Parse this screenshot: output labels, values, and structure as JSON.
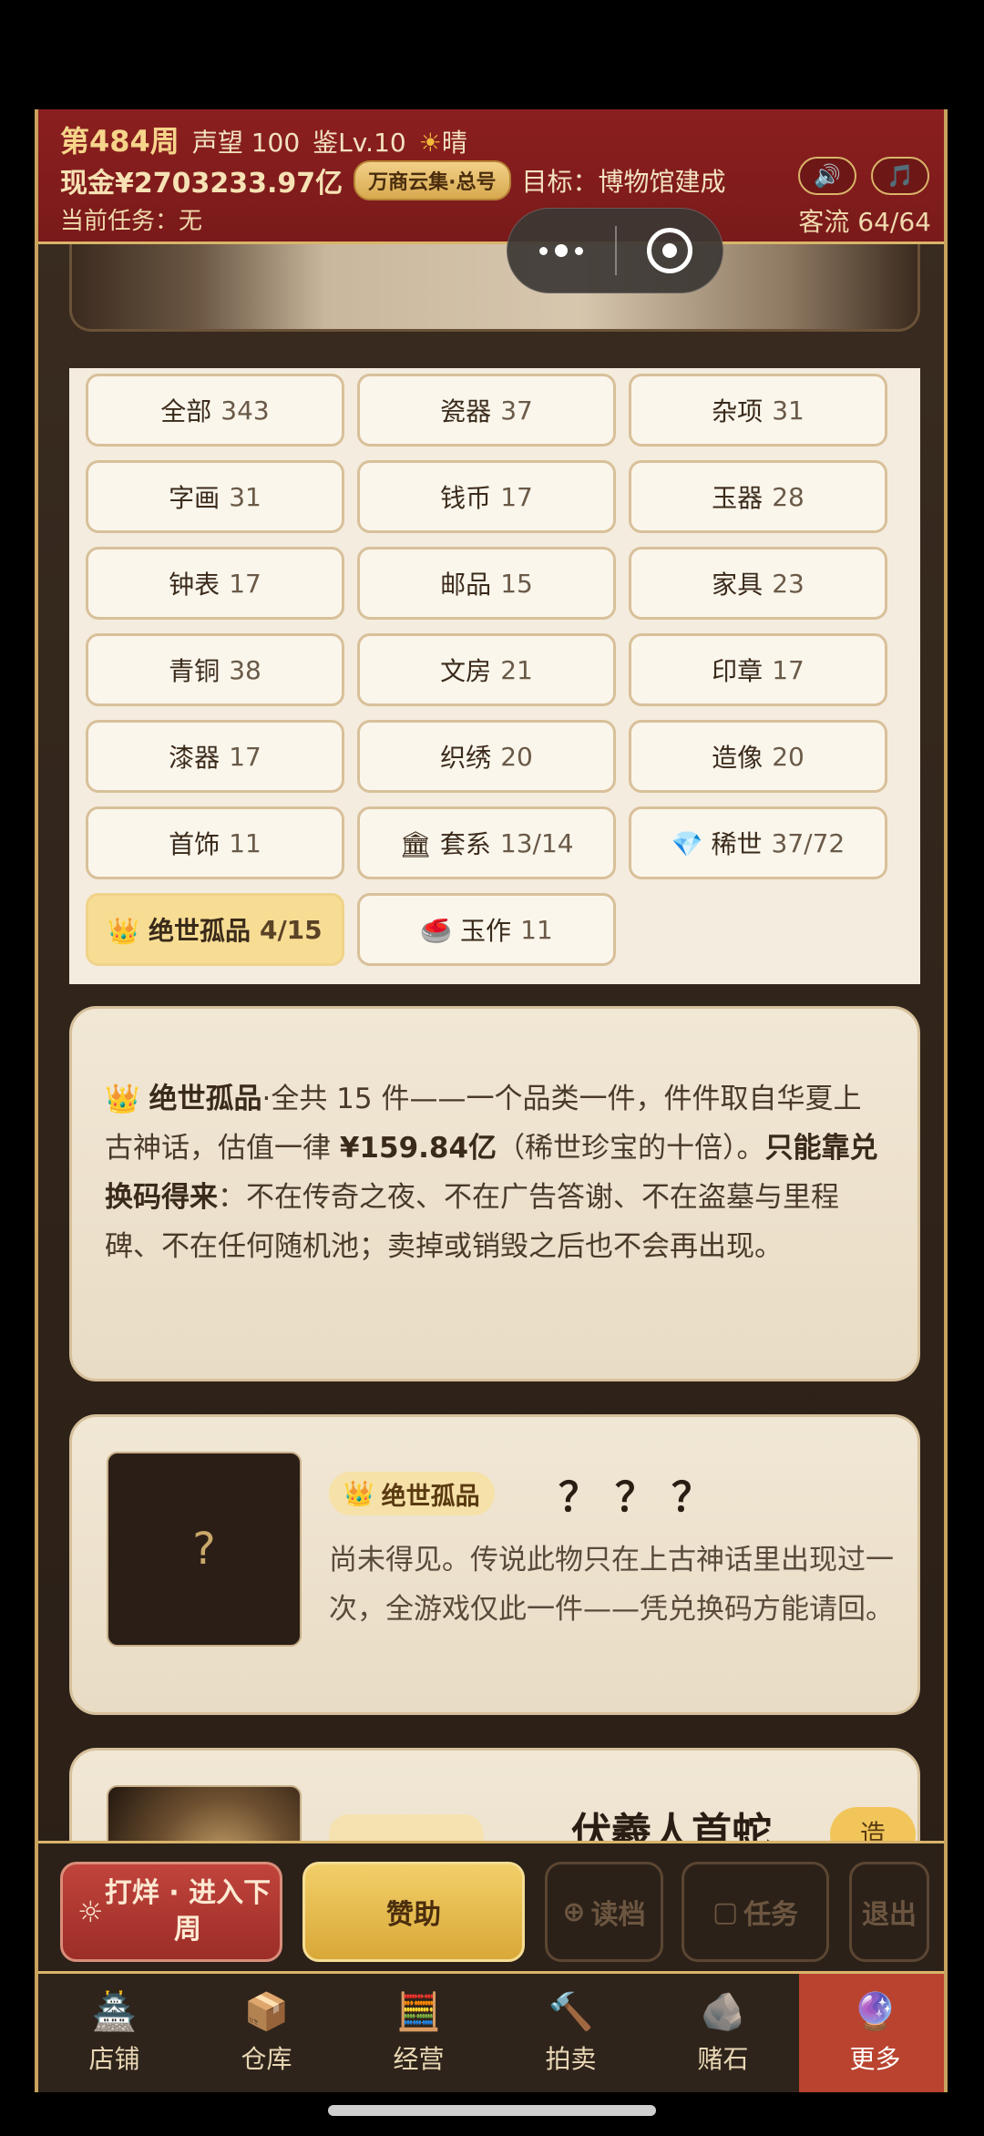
{
  "header": {
    "week": "第484周",
    "reputation": "声望 100",
    "appraisal": "鉴Lv.10",
    "weather_icon": "☀",
    "weather": "晴",
    "cash": "现金¥2703233.97亿",
    "badge": "万商云集·总号",
    "goal": "目标：博物馆建成",
    "task": "当前任务：无",
    "traffic": "客流 64/64",
    "sound_icon": "🔊",
    "music_icon": "🎵"
  },
  "categories": [
    {
      "label": "全部",
      "count": "343"
    },
    {
      "label": "瓷器",
      "count": "37"
    },
    {
      "label": "杂项",
      "count": "31"
    },
    {
      "label": "字画",
      "count": "31"
    },
    {
      "label": "钱币",
      "count": "17"
    },
    {
      "label": "玉器",
      "count": "28"
    },
    {
      "label": "钟表",
      "count": "17"
    },
    {
      "label": "邮品",
      "count": "15"
    },
    {
      "label": "家具",
      "count": "23"
    },
    {
      "label": "青铜",
      "count": "38"
    },
    {
      "label": "文房",
      "count": "21"
    },
    {
      "label": "印章",
      "count": "17"
    },
    {
      "label": "漆器",
      "count": "17"
    },
    {
      "label": "织绣",
      "count": "20"
    },
    {
      "label": "造像",
      "count": "20"
    },
    {
      "label": "首饰",
      "count": "11"
    },
    {
      "label": "🏛 套系",
      "count": "13/14"
    },
    {
      "label": "💎 稀世",
      "count": "37/72"
    },
    {
      "label": "👑 绝世孤品",
      "count": "4/15"
    },
    {
      "label": "🥌 玉作",
      "count": "11"
    }
  ],
  "info": {
    "crown": "👑",
    "title": "绝世孤品",
    "t1": "·全共 15 件——一个品类一件，件件取自华夏上古神话，估值一律 ",
    "price": "¥159.84亿",
    "t2": "（稀世珍宝的十倍）。",
    "bold2": "只能靠兑换码得来",
    "t3": "：不在传奇之夜、不在广告答谢、不在盗墓与里程碑、不在任何随机池；卖掉或销毁之后也不会再出现。"
  },
  "item": {
    "placeholder": "?",
    "tag_icon": "👑",
    "tag": "绝世孤品",
    "name": "？？？",
    "desc": "尚未得见。传说此物只在上古神话里出现过一次，全游戏仅此一件——凭兑换码方能请回。"
  },
  "item2": {
    "name": "伏羲人首蛇",
    "craft": "造"
  },
  "actions": {
    "end_week_icon": "☼",
    "end_week": "打烊 · 进入下周",
    "sponsor": "赞助",
    "load_icon": "⊕",
    "load": "读档",
    "task_icon": "▢",
    "task": "任务",
    "quit": "退出"
  },
  "tabs": [
    {
      "icon": "🏯",
      "label": "店铺"
    },
    {
      "icon": "📦",
      "label": "仓库"
    },
    {
      "icon": "🧮",
      "label": "经营"
    },
    {
      "icon": "🔨",
      "label": "拍卖"
    },
    {
      "icon": "🪨",
      "label": "赌石"
    },
    {
      "icon": "🔮",
      "label": "更多"
    }
  ]
}
